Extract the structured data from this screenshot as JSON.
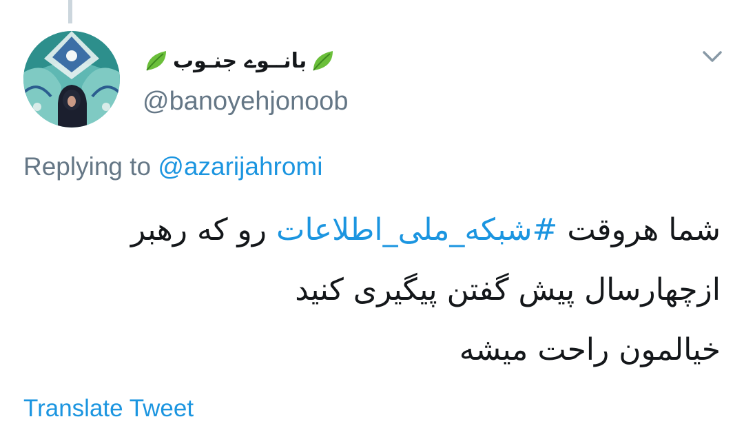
{
  "tweet": {
    "author": {
      "display_name": "بانــوے جنـوب",
      "display_name_decoration": "leaf-icon",
      "handle": "@banoyehjonoob",
      "avatar_icon": "user-avatar"
    },
    "menu_icon": "chevron-down-icon",
    "reply_context": {
      "prefix": "Replying to",
      "mention": "@azarijahromi"
    },
    "body": {
      "line1_text": "شما هروقت",
      "line1_hashtag": "#شبکه_ملی_اطلاعات",
      "line1_text_after": "رو که رهبر",
      "line2": "ازچهارسال پیش گفتن پیگیری کنید",
      "line3": "خیالمون راحت میشه"
    },
    "translate_label": "Translate Tweet"
  },
  "colors": {
    "text_primary": "#14171a",
    "text_secondary": "#657786",
    "link": "#1b95e0",
    "thread_line": "#ccd6dd",
    "leaf_green": "#6bbf3a"
  }
}
